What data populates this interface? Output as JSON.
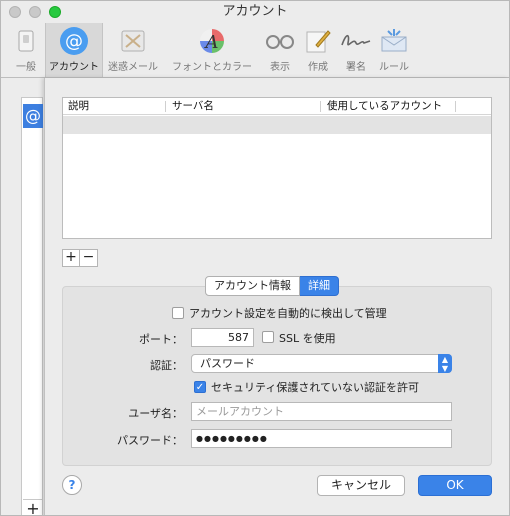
{
  "window": {
    "title": "アカウント"
  },
  "toolbar": {
    "items": [
      {
        "label": "一般",
        "icon": "general-switch-icon"
      },
      {
        "label": "アカウント",
        "icon": "at-sign-icon",
        "active": true
      },
      {
        "label": "迷惑メール",
        "icon": "junk-trash-icon"
      },
      {
        "label": "フォントとカラー",
        "icon": "font-color-icon"
      },
      {
        "label": "表示",
        "icon": "glasses-icon"
      },
      {
        "label": "作成",
        "icon": "compose-pencil-icon"
      },
      {
        "label": "署名",
        "icon": "signature-icon"
      },
      {
        "label": "ルール",
        "icon": "rules-envelope-icon"
      }
    ]
  },
  "sidebar": {
    "account_icon": "@",
    "add_label": "+"
  },
  "table": {
    "columns": [
      "説明",
      "サーバ名",
      "使用しているアカウント"
    ]
  },
  "table_buttons": {
    "add": "+",
    "remove": "−"
  },
  "tabs": {
    "info": "アカウント情報",
    "detail": "詳細"
  },
  "form": {
    "auto_detect_label": "アカウント設定を自動的に検出して管理",
    "port_label": "ポート：",
    "port_value": "587",
    "ssl_label": "SSL を使用",
    "auth_label": "認証：",
    "auth_value": "パスワード",
    "insecure_label": "セキュリティ保護されていない認証を許可",
    "user_label": "ユーザ名：",
    "user_placeholder": "メールアカウント",
    "password_label": "パスワード：",
    "password_value": "●●●●●●●●●"
  },
  "buttons": {
    "help": "?",
    "cancel": "キャンセル",
    "ok": "OK"
  },
  "colors": {
    "accent": "#3a83e8",
    "selected_row": "#e3e3e3"
  }
}
